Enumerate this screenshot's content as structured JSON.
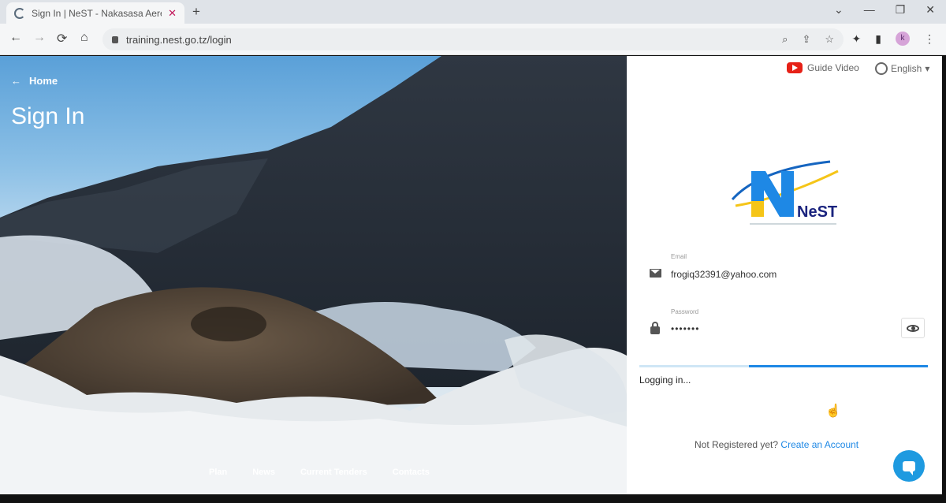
{
  "browser": {
    "tab_title": "Sign In | NeST - Nakasasa Aere",
    "tab_close": "✕",
    "new_tab": "+",
    "window_controls": [
      "⌄",
      "—",
      "❐",
      "✕"
    ],
    "url": "training.nest.go.tz/login",
    "nav": {
      "back": "←",
      "forward": "→",
      "reload": "⟳",
      "home": "⌂"
    },
    "omni_icons": [
      "⌕",
      "⇪",
      "☆"
    ],
    "ext_icons": [
      "✦",
      "▮",
      "⋮"
    ],
    "profile_initial": "k"
  },
  "hero": {
    "home_label": "Home",
    "back_arrow": "←",
    "title": "Sign In",
    "footer_links": [
      "Plan",
      "News",
      "Current Tenders",
      "Contacts"
    ]
  },
  "panel": {
    "guide_label": "Guide Video",
    "language": "English",
    "language_chevron": "▾",
    "logo_text": "NeST",
    "email_label": "Email",
    "email_value": "frogiq32391@yahoo.com",
    "password_label": "Password",
    "password_value": "•••••••",
    "progress": 0.62,
    "status_text": "Logging in...",
    "register_prompt": "Not Registered yet?",
    "register_link": "Create an Account",
    "cursor_glyph": "☝"
  },
  "colors": {
    "accent": "#1e88e5",
    "chat": "#1e9ae0"
  }
}
